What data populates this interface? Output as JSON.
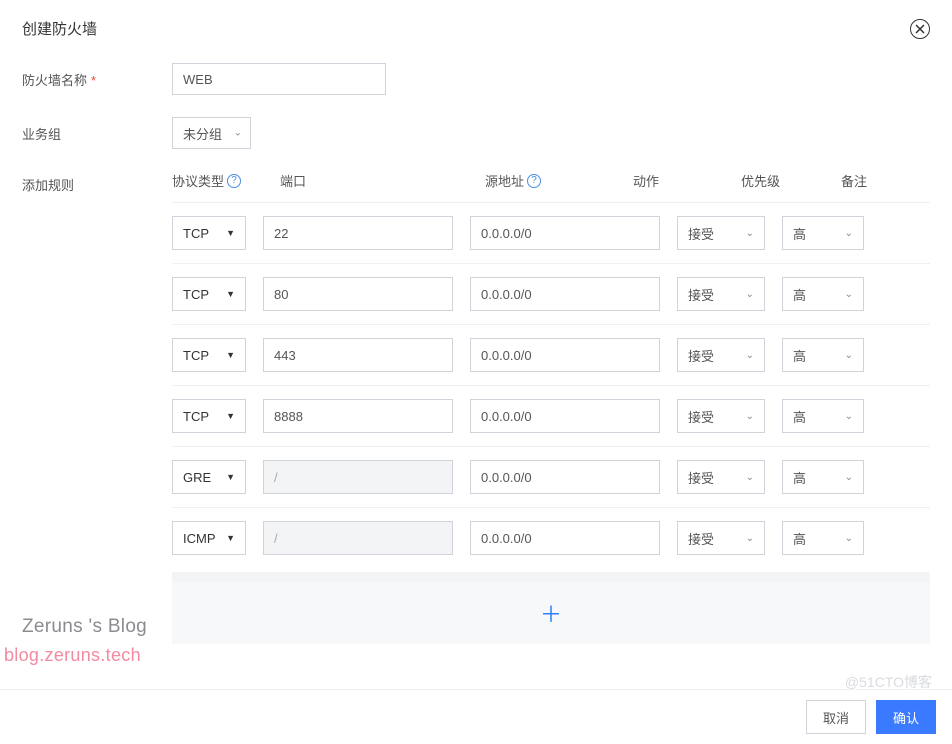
{
  "modal": {
    "title": "创建防火墙"
  },
  "form": {
    "name_label": "防火墙名称",
    "name_value": "WEB",
    "group_label": "业务组",
    "group_value": "未分组",
    "rules_label": "添加规则"
  },
  "table": {
    "headers": {
      "protocol": "协议类型",
      "port": "端口",
      "source": "源地址",
      "action": "动作",
      "priority": "优先级",
      "remark": "备注"
    },
    "rows": [
      {
        "protocol": "TCP",
        "port": "22",
        "port_disabled": false,
        "source": "0.0.0.0/0",
        "action": "接受",
        "remark": "高"
      },
      {
        "protocol": "TCP",
        "port": "80",
        "port_disabled": false,
        "source": "0.0.0.0/0",
        "action": "接受",
        "remark": "高"
      },
      {
        "protocol": "TCP",
        "port": "443",
        "port_disabled": false,
        "source": "0.0.0.0/0",
        "action": "接受",
        "remark": "高"
      },
      {
        "protocol": "TCP",
        "port": "8888",
        "port_disabled": false,
        "source": "0.0.0.0/0",
        "action": "接受",
        "remark": "高"
      },
      {
        "protocol": "GRE",
        "port": "/",
        "port_disabled": true,
        "source": "0.0.0.0/0",
        "action": "接受",
        "remark": "高"
      },
      {
        "protocol": "ICMP",
        "port": "/",
        "port_disabled": true,
        "source": "0.0.0.0/0",
        "action": "接受",
        "remark": "高"
      }
    ]
  },
  "buttons": {
    "add": "＋",
    "cancel": "取消",
    "confirm": "确认"
  },
  "watermarks": {
    "w1": "Zeruns 's Blog",
    "w2": "blog.zeruns.tech",
    "w3": "@51CTO博客"
  }
}
